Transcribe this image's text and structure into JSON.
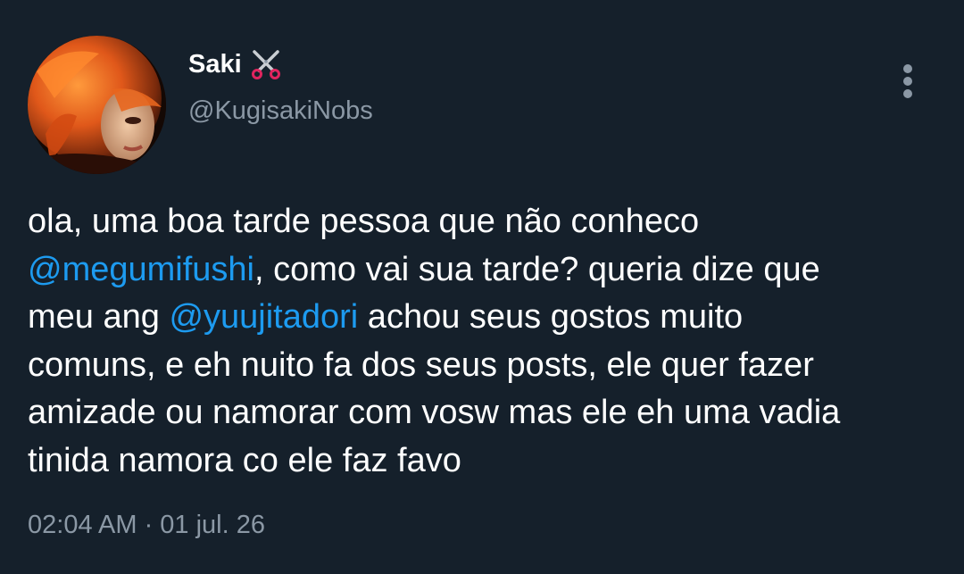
{
  "tweet": {
    "display_name": "Saki",
    "name_emoji": "✂️",
    "handle": "@KugisakiNobs",
    "body": {
      "line1": "ola, uma boa tarde pessoa que não conheco",
      "mention1": "@megumifushi",
      "line2_rest": ", como vai sua tarde? queria dize que",
      "line3_pre": "meu ang ",
      "mention2": "@yuujitadori",
      "line3_rest": " achou seus gostos muito",
      "line4": "comuns, e eh nuito fa dos seus posts, ele quer fazer",
      "line5": "amizade ou namorar com vosw mas ele eh uma vadia",
      "line6": "tinida namora co ele faz favo"
    },
    "timestamp": "02:04 AM · 01 jul. 26"
  },
  "icons": {
    "avatar": "avatar-photo",
    "scissors": "scissors-icon",
    "more": "more-vertical-icon"
  },
  "colors": {
    "background": "#15202b",
    "text": "#ffffff",
    "secondary": "#8b98a5",
    "link": "#1d9bf0"
  }
}
